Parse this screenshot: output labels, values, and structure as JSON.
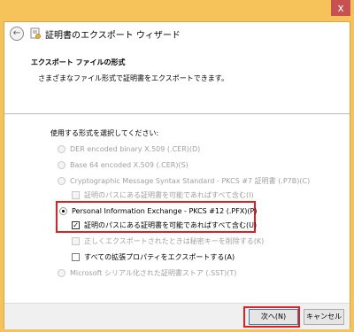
{
  "window": {
    "close_glyph": "x"
  },
  "wizard": {
    "title": "証明書のエクスポート ウィザード",
    "back_glyph": "←"
  },
  "page": {
    "section_title": "エクスポート ファイルの形式",
    "section_subtitle": "さまざまなファイル形式で証明書をエクスポートできます。",
    "prompt": "使用する形式を選択してください:"
  },
  "options": {
    "der": "DER encoded binary X.509 (.CER)(D)",
    "base64": "Base 64 encoded X.509 (.CER)(S)",
    "pkcs7": "Cryptographic Message Syntax Standard - PKCS #7 証明書 (.P7B)(C)",
    "pkcs7_path": "証明のパスにある証明書を可能であればすべて含む(I)",
    "pfx": "Personal Information Exchange - PKCS #12 (.PFX)(P)",
    "pfx_path": "証明のパスにある証明書を可能であればすべて含む(U)",
    "delete_key": "正しくエクスポートされたときは秘密キーを削除する(K)",
    "export_props": "すべての拡張プロパティをエクスポートする(A)",
    "sst": "Microsoft シリアル化された証明書ストア (.SST)(T)"
  },
  "state": {
    "selected_format": "pfx",
    "pfx_path_checked": true,
    "check_glyph": "✓"
  },
  "footer": {
    "next_label": "次へ(N)",
    "cancel_label": "キャンセル"
  },
  "colors": {
    "title_bar": "#f6c25a",
    "highlight": "#e02020",
    "close_button": "#c75050"
  }
}
